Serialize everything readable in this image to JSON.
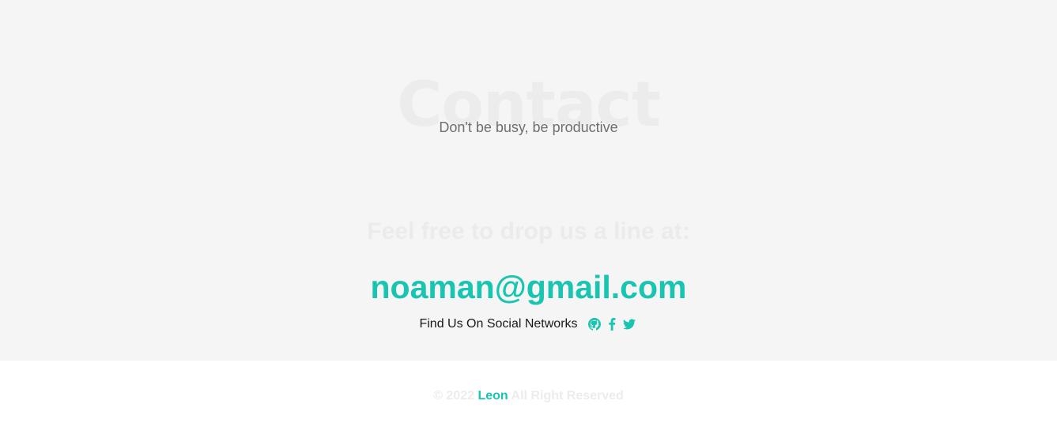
{
  "contact": {
    "background_title": "Contact",
    "subtitle": "Don't be busy, be productive",
    "drop_line": "Feel free to drop us a line at:",
    "email": "noaman@gmail.com",
    "social_label": "Find Us On Social Networks",
    "social_links": [
      {
        "icon": "github-icon"
      },
      {
        "icon": "facebook-icon"
      },
      {
        "icon": "twitter-icon"
      }
    ]
  },
  "footer": {
    "copyright_prefix": "© 2022",
    "brand": "Leon",
    "copyright_suffix": "All Right Reserved"
  },
  "colors": {
    "accent": "#19c5b0",
    "section_background": "#f5f5f5",
    "page_background": "#ffffff",
    "muted_text": "#6e6e6e"
  }
}
